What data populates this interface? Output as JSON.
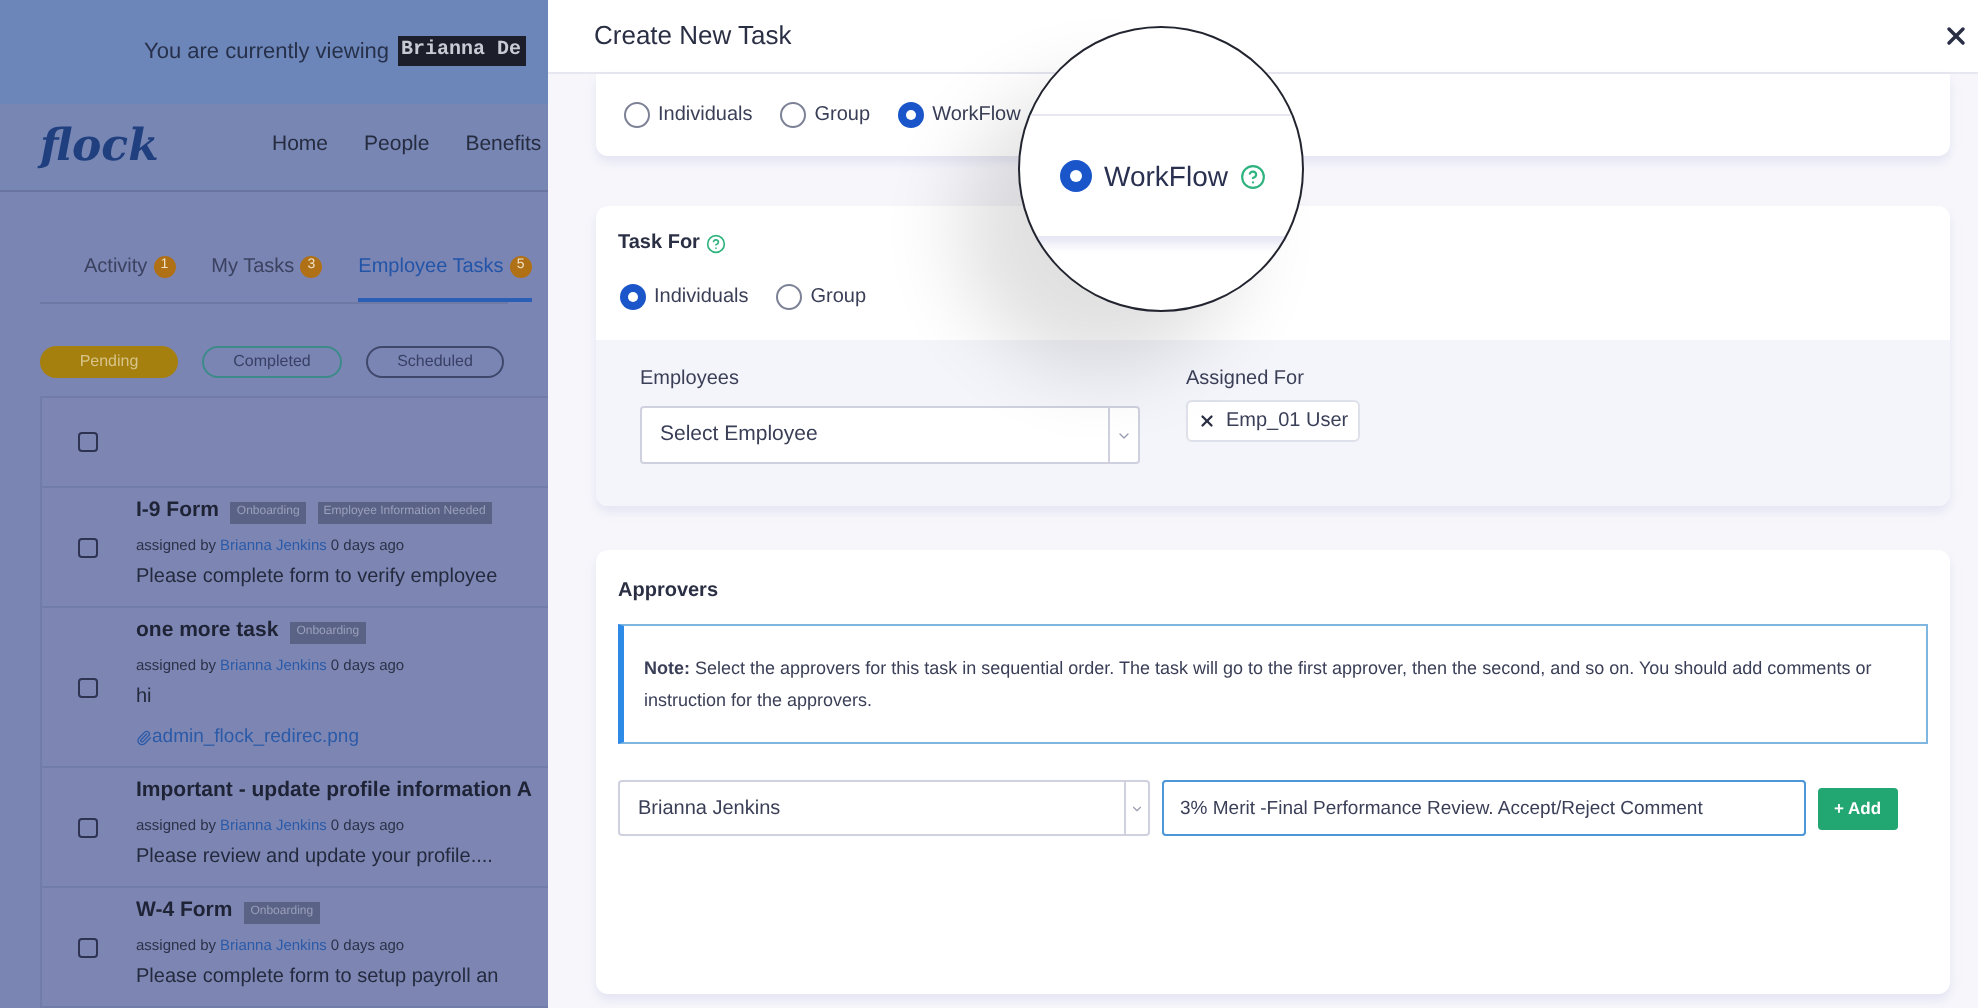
{
  "background_page": {
    "banner": {
      "text": "You are currently viewing",
      "user": "Brianna De"
    },
    "logo": "flock",
    "nav": [
      "Home",
      "People",
      "Benefits"
    ],
    "select_all_checked": false,
    "tabs": [
      {
        "label": "Activity",
        "count": "1",
        "selected": false
      },
      {
        "label": "My Tasks",
        "count": "3",
        "selected": false
      },
      {
        "label": "Employee Tasks",
        "count": "5",
        "selected": true
      }
    ],
    "filters": [
      {
        "label": "Pending",
        "selected": true
      },
      {
        "label": "Completed",
        "selected": false
      },
      {
        "label": "Scheduled",
        "selected": false
      }
    ],
    "tasks": [
      {
        "title": "I-9 Form",
        "tags": [
          "Onboarding",
          "Employee Information Needed"
        ],
        "assigned_prefix": "assigned by",
        "assigned_by": "Brianna Jenkins",
        "assigned_suffix": "0 days ago",
        "body": "Please complete form to verify employee",
        "checked": false
      },
      {
        "title": "one more task",
        "tags": [
          "Onboarding"
        ],
        "assigned_prefix": "assigned by",
        "assigned_by": "Brianna Jenkins",
        "assigned_suffix": "0 days ago",
        "body": "hi",
        "attachment": "admin_flock_redirec.png",
        "checked": false
      },
      {
        "title": "Important - update profile information A",
        "assigned_prefix": "assigned by",
        "assigned_by": "Brianna Jenkins",
        "assigned_suffix": "0 days ago",
        "body": "Please review and update your profile....",
        "checked": false
      },
      {
        "title": "W-4 Form",
        "tags": [
          "Onboarding"
        ],
        "assigned_prefix": "assigned by",
        "assigned_by": "Brianna Jenkins",
        "assigned_suffix": "0 days ago",
        "body": "Please complete form to setup payroll an",
        "checked": false
      }
    ]
  },
  "drawer": {
    "title": "Create New Task",
    "task_type": [
      {
        "label": "Individuals",
        "selected": false,
        "help": false
      },
      {
        "label": "Group",
        "selected": false,
        "help": false
      },
      {
        "label": "WorkFlow",
        "selected": true,
        "help": true
      }
    ],
    "magnifier": {
      "label": "WorkFlow",
      "selected": true
    },
    "task_for": {
      "title": "Task For",
      "options": [
        {
          "label": "Individuals",
          "selected": true
        },
        {
          "label": "Group",
          "selected": false
        }
      ],
      "employees_label": "Employees",
      "employees_placeholder": "Select Employee",
      "assigned_label": "Assigned For",
      "assigned": [
        "Emp_01 User"
      ]
    },
    "approvers": {
      "title": "Approvers",
      "note_label": "Note:",
      "note": "Select the approvers for this task in sequential order. The task will go to the first approver, then the second, and so on. You should add comments or instruction for the approvers.",
      "approver": "Brianna Jenkins",
      "comment": "3% Merit -Final Performance Review. Accept/Reject Comment",
      "add_button": "+ Add"
    }
  }
}
